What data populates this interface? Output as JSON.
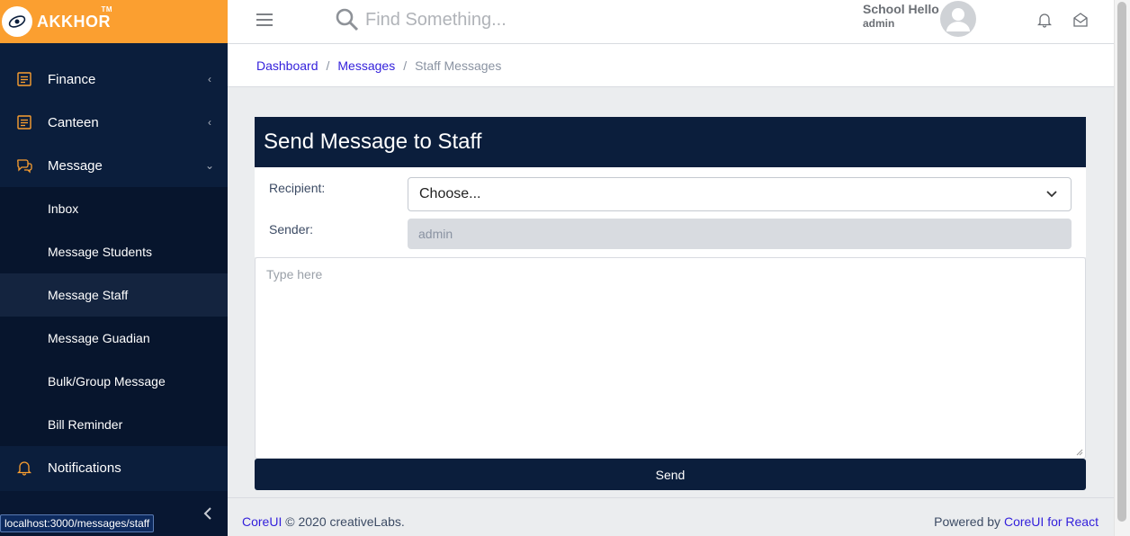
{
  "brand": {
    "name": "AKKHOR",
    "tm": "TM"
  },
  "sidebar": {
    "items": [
      {
        "label": "Finance",
        "icon": "document-icon"
      },
      {
        "label": "Canteen",
        "icon": "document-icon"
      },
      {
        "label": "Message",
        "icon": "chat-icon"
      }
    ],
    "sub_items": [
      "Inbox",
      "Message Students",
      "Message Staff",
      "Message Guadian",
      "Bulk/Group Message",
      "Bill Reminder"
    ],
    "active_sub": "Message Staff",
    "notifications": "Notifications"
  },
  "status_url": "localhost:3000/messages/staff",
  "header": {
    "search_placeholder": "Find Something...",
    "user_name": "School Hello",
    "user_role": "admin"
  },
  "breadcrumb": {
    "items": [
      "Dashboard",
      "Messages"
    ],
    "current": "Staff Messages",
    "separator": "/"
  },
  "form": {
    "title": "Send Message to Staff",
    "recipient_label": "Recipient:",
    "recipient_value": "Choose...",
    "sender_label": "Sender:",
    "sender_value": "admin",
    "message_placeholder": "Type here",
    "send_label": "Send"
  },
  "footer": {
    "left_link": "CoreUI",
    "left_text": "© 2020 creativeLabs.",
    "right_text": "Powered by",
    "right_link": "CoreUI for React"
  },
  "colors": {
    "brand_orange": "#fb9f30",
    "navy": "#0b1e3c",
    "link": "#321fdb"
  }
}
